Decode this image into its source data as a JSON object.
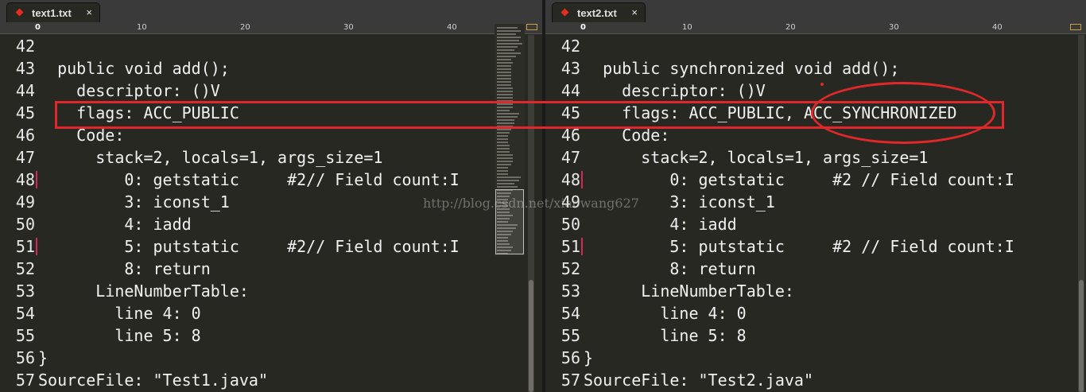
{
  "left": {
    "tab": {
      "title": "text1.txt",
      "close": "×"
    },
    "ruler": [
      "0",
      "10",
      "20",
      "30",
      "40"
    ],
    "lines": [
      {
        "n": "42",
        "t": ""
      },
      {
        "n": "43",
        "t": "  public void add();"
      },
      {
        "n": "44",
        "t": "    descriptor: ()V"
      },
      {
        "n": "45",
        "t": "    flags: ACC_PUBLIC"
      },
      {
        "n": "46",
        "t": "    Code:"
      },
      {
        "n": "47",
        "t": "      stack=2, locals=1, args_size=1"
      },
      {
        "n": "48",
        "t": "         0: getstatic     #2// Field count:I"
      },
      {
        "n": "49",
        "t": "         3: iconst_1"
      },
      {
        "n": "50",
        "t": "         4: iadd"
      },
      {
        "n": "51",
        "t": "         5: putstatic     #2// Field count:I"
      },
      {
        "n": "52",
        "t": "         8: return"
      },
      {
        "n": "53",
        "t": "      LineNumberTable:"
      },
      {
        "n": "54",
        "t": "        line 4: 0"
      },
      {
        "n": "55",
        "t": "        line 5: 8"
      },
      {
        "n": "56",
        "t": "}"
      },
      {
        "n": "57",
        "t": "SourceFile: \"Test1.java\""
      }
    ]
  },
  "right": {
    "tab": {
      "title": "text2.txt",
      "close": "×"
    },
    "ruler": [
      "0",
      "10",
      "20",
      "30",
      "40"
    ],
    "lines": [
      {
        "n": "42",
        "t": ""
      },
      {
        "n": "43",
        "t": "  public synchronized void add();"
      },
      {
        "n": "44",
        "t": "    descriptor: ()V"
      },
      {
        "n": "45",
        "t": "    flags: ACC_PUBLIC, ACC_SYNCHRONIZED"
      },
      {
        "n": "46",
        "t": "    Code:"
      },
      {
        "n": "47",
        "t": "      stack=2, locals=1, args_size=1"
      },
      {
        "n": "48",
        "t": "         0: getstatic     #2 // Field count:I"
      },
      {
        "n": "49",
        "t": "         3: iconst_1"
      },
      {
        "n": "50",
        "t": "         4: iadd"
      },
      {
        "n": "51",
        "t": "         5: putstatic     #2 // Field count:I"
      },
      {
        "n": "52",
        "t": "         8: return"
      },
      {
        "n": "53",
        "t": "      LineNumberTable:"
      },
      {
        "n": "54",
        "t": "        line 4: 0"
      },
      {
        "n": "55",
        "t": "        line 5: 8"
      },
      {
        "n": "56",
        "t": "}"
      },
      {
        "n": "57",
        "t": "SourceFile: \"Test2.java\""
      }
    ]
  },
  "watermark": "http://blog.csdn.net/xiaowang627",
  "colors": {
    "background": "#272822",
    "text": "#f1f1f1",
    "annotation": "#e0282a",
    "dirty_marker": "#e32d1f"
  }
}
